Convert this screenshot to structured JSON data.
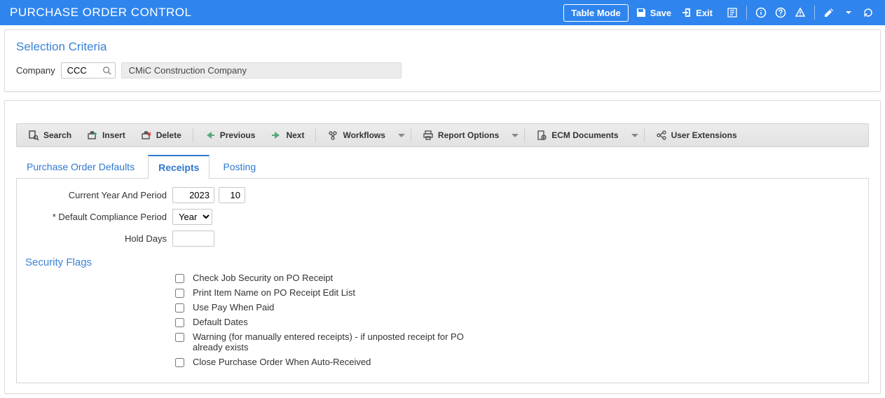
{
  "header": {
    "title": "PURCHASE ORDER CONTROL",
    "table_mode_label": "Table Mode",
    "save_label": "Save",
    "exit_label": "Exit"
  },
  "selection": {
    "panel_title": "Selection Criteria",
    "company_label": "Company",
    "company_code": "CCC",
    "company_name": "CMiC Construction Company"
  },
  "toolbar": {
    "search": "Search",
    "insert": "Insert",
    "delete": "Delete",
    "previous": "Previous",
    "next": "Next",
    "workflows": "Workflows",
    "report_options": "Report Options",
    "ecm_documents": "ECM Documents",
    "user_extensions": "User Extensions"
  },
  "tabs": {
    "defaults": "Purchase Order Defaults",
    "receipts": "Receipts",
    "posting": "Posting"
  },
  "receipts": {
    "current_year_period_label": "Current Year And Period",
    "year": "2023",
    "period": "10",
    "default_compliance_period_label": "* Default Compliance Period",
    "compliance_period_value": "Year",
    "compliance_period_options": [
      "Year"
    ],
    "hold_days_label": "Hold Days",
    "hold_days_value": ""
  },
  "security_flags": {
    "title": "Security Flags",
    "items": [
      "Check Job Security on PO Receipt",
      "Print Item Name on PO Receipt Edit List",
      "Use Pay When Paid",
      "Default Dates",
      "Warning (for manually entered receipts) - if unposted receipt for PO already exists",
      "Close Purchase Order When Auto-Received"
    ]
  }
}
